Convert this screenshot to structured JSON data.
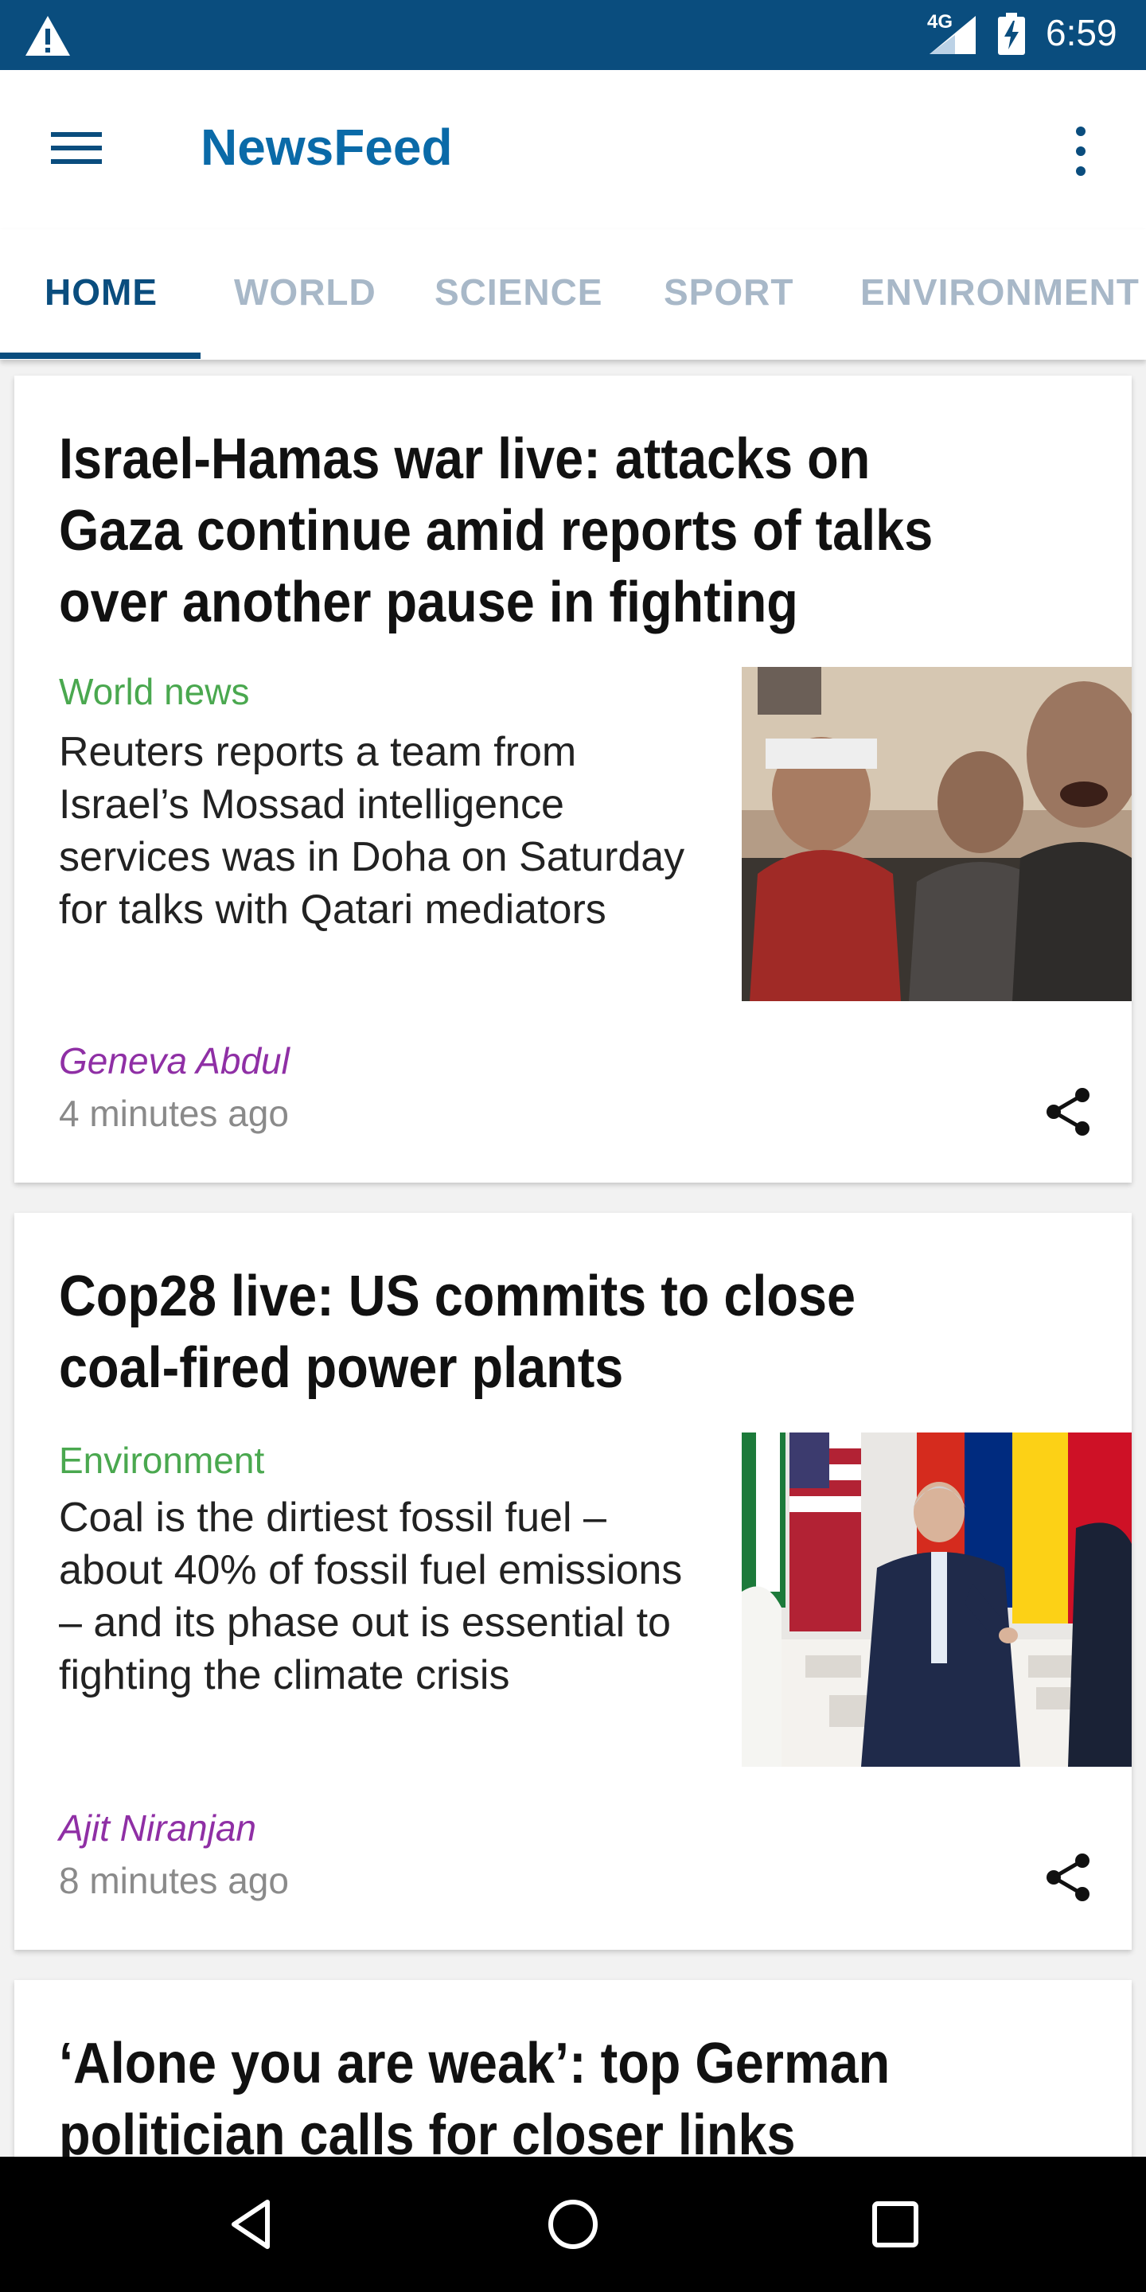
{
  "status_bar": {
    "time": "6:59",
    "network": "4G"
  },
  "app_bar": {
    "title": "NewsFeed"
  },
  "tabs": [
    {
      "label": "HOME"
    },
    {
      "label": "WORLD"
    },
    {
      "label": "SCIENCE"
    },
    {
      "label": "SPORT"
    },
    {
      "label": "ENVIRONMENT"
    }
  ],
  "articles": [
    {
      "headline": "Israel-Hamas war live: attacks on Gaza continue amid reports of talks over another pause in fighting",
      "section": "World news",
      "summary": "Reuters reports a team from Israel’s Mossad intelligence services was in Doha on Saturday for talks with Qatari mediators",
      "author": "Geneva Abdul",
      "age": "4 minutes ago"
    },
    {
      "headline": "Cop28 live: US commits to close coal-fired power plants",
      "section": "Environment",
      "summary": "Coal is the dirtiest fossil fuel – about 40% of fossil fuel emissions – and its phase out is essential to fighting the climate crisis",
      "author": "Ajit Niranjan",
      "age": "8 minutes ago"
    },
    {
      "headline": "‘Alone you are weak’: top German politician calls for closer links between"
    }
  ],
  "colors": {
    "primary": "#0a4d7e",
    "title": "#0a6aa8",
    "section": "#4aa84f",
    "author": "#8f2fa5",
    "tab_inactive": "#a8b8c8"
  }
}
